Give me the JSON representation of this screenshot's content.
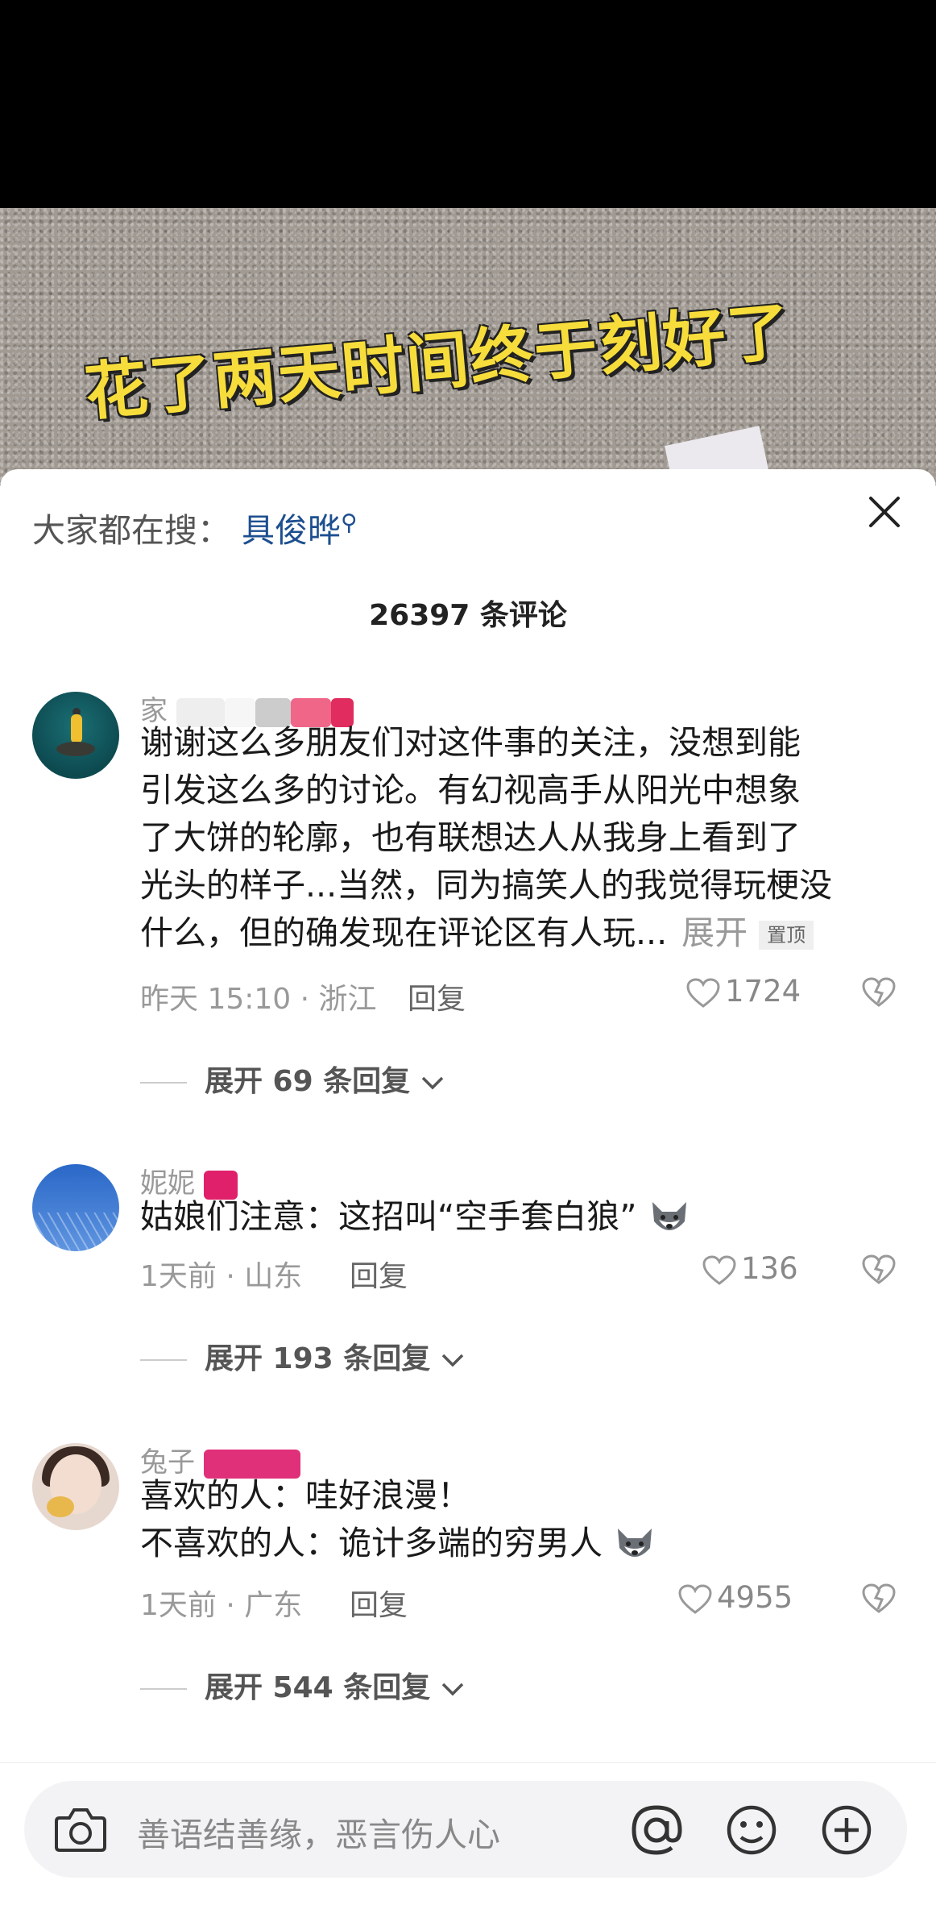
{
  "video": {
    "caption": "花了两天时间终于刻好了"
  },
  "search": {
    "prefix": "大家都在搜：",
    "term": "具俊晔"
  },
  "comments_header": {
    "count_label": "26397 条评论"
  },
  "comments": [
    {
      "username": "家",
      "lines": [
        "谢谢这么多朋友们对这件事的关注，没想到能",
        "引发这么多的讨论。有幻视高手从阳光中想象",
        "了大饼的轮廓，也有联想达人从我身上看到了",
        "光头的样子...当然，同为搞笑人的我觉得玩梗没",
        "什么，但的确发现在评论区有人玩..."
      ],
      "expand_label": "展开",
      "pin_label": "置顶",
      "meta": "昨天 15:10 · 浙江",
      "reply_label": "回复",
      "likes": "1724",
      "more_replies": "展开 69 条回复"
    },
    {
      "username": "妮妮",
      "lines": [
        "姑娘们注意：这招叫“空手套白狼”"
      ],
      "meta": "1天前 · 山东",
      "reply_label": "回复",
      "likes": "136",
      "more_replies": "展开 193 条回复"
    },
    {
      "username": "兔子",
      "lines": [
        "喜欢的人：哇好浪漫！",
        "不喜欢的人：诡计多端的穷男人"
      ],
      "meta": "1天前 · 广东",
      "reply_label": "回复",
      "likes": "4955",
      "more_replies": "展开 544 条回复"
    }
  ],
  "input": {
    "placeholder": "善语结善缘，恶言伤人心"
  },
  "icons": [
    "search-icon",
    "close-icon",
    "heart-icon",
    "dislike-icon",
    "chevron-down-icon",
    "camera-icon",
    "at-icon",
    "emoji-icon",
    "plus-icon",
    "wolf-emoji"
  ],
  "colors": {
    "link": "#1d4f8f",
    "caption": "#f7dd3b",
    "muted": "#999999"
  }
}
